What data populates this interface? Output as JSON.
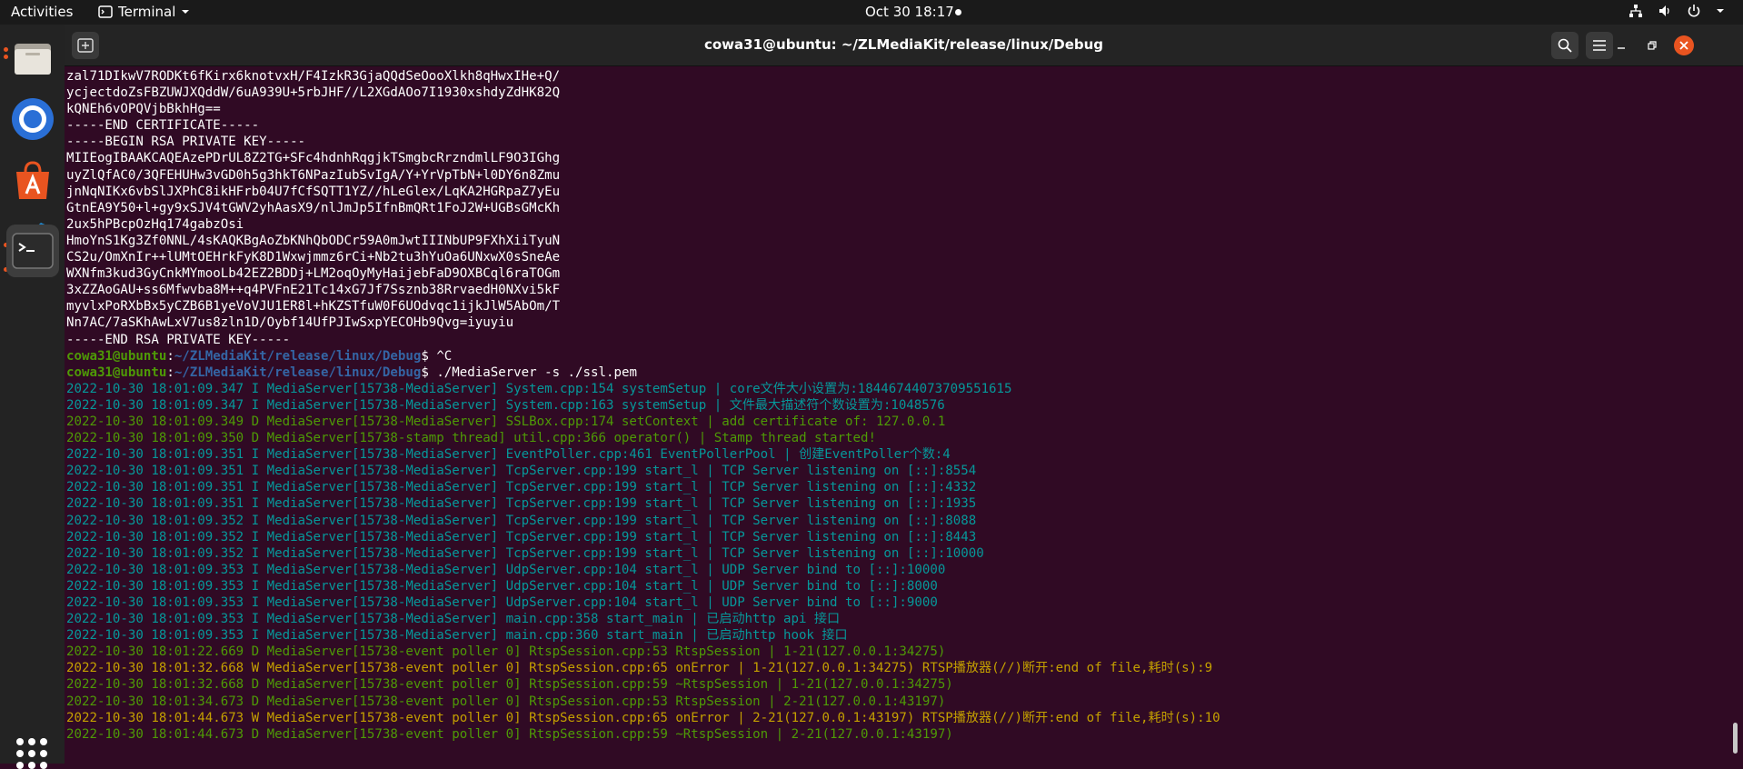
{
  "topbar": {
    "activities": "Activities",
    "app_menu": "Terminal",
    "clock": "Oct 30  18:17"
  },
  "window": {
    "title": "cowa31@ubuntu: ~/ZLMediaKit/release/linux/Debug"
  },
  "dock": {
    "items": [
      "files-icon",
      "chromium-icon",
      "app-store-icon",
      "vscode-icon",
      "terminal-icon",
      "show-applications-icon"
    ]
  },
  "colors": {
    "terminal_bg": "#300a24",
    "green": "#4e9a06",
    "cyan": "#06989a",
    "yellow": "#c4a000",
    "prompt_path": "#3465a4",
    "close": "#e95420"
  },
  "terminal": {
    "lines": [
      {
        "style": "white",
        "text": "zal71DIkwV7RODKt6fKirx6knotvxH/F4IzkR3GjaQQdSeOooXlkh8qHwxIHe+Q/"
      },
      {
        "style": "white",
        "text": "ycjectdoZsFBZUWJXQddW/6uA939U+5rbJHF//L2XGdAOo7I1930xshdyZdHK82Q"
      },
      {
        "style": "white",
        "text": "kQNEh6vOPQVjbBkhHg=="
      },
      {
        "style": "white",
        "text": "-----END CERTIFICATE-----"
      },
      {
        "style": "white",
        "text": "-----BEGIN RSA PRIVATE KEY-----"
      },
      {
        "style": "white",
        "text": "MIIEogIBAAKCAQEAzePDrUL8Z2TG+SFc4hdnhRqgjkTSmgbcRrzndmlLF9O3IGhg"
      },
      {
        "style": "white",
        "text": "uyZlQfAC0/3QFEHUHw3vGD0h5g3hkT6NPazIubSvIgA/Y+YrVpTbN+l0DY6n8Zmu"
      },
      {
        "style": "white",
        "text": "jnNqNIKx6vbSlJXPhC8ikHFrb04U7fCfSQTT1YZ//hLeGlex/LqKA2HGRpaZ7yEu"
      },
      {
        "style": "white",
        "text": "GtnEA9Y50+l+gy9xSJV4tGWV2yhAasX9/nlJmJp5IfnBmQRt1FoJ2W+UGBsGMcKh"
      },
      {
        "style": "white",
        "text": "2ux5hPBcpOzHq174gabzOsi"
      },
      {
        "style": "white",
        "text": "HmoYnS1Kg3Zf0NNL/4sKAQKBgAoZbKNhQbODCr59A0mJwtIIINbUP9FXhXiiTyuN"
      },
      {
        "style": "white",
        "text": "CS2u/OmXnIr++lUMtOEHrkFyK8D1Wxwjmmz6rCi+Nb2tu3hYuOa6UNxwX0sSneAe"
      },
      {
        "style": "white",
        "text": "WXNfm3kud3GyCnkMYmooLb42EZ2BDDj+LM2oqOyMyHaijebFaD9OXBCql6raTOGm"
      },
      {
        "style": "white",
        "text": "3xZZAoGAU+ss6Mfwvba8M++q4PVFnE21Tc14xG7Jf7Ssznb38RrvaedH0NXvi5kF"
      },
      {
        "style": "white",
        "text": "myvlxPoRXbBx5yCZB6B1yeVoVJU1ER8l+hKZSTfuW0F6UOdvqc1ijkJlW5AbOm/T"
      },
      {
        "style": "white",
        "text": "Nn7AC/7aSKhAwLxV7us8zln1D/Oybf14UfPJIwSxpYECOHb9Qvg=iyuyiu"
      },
      {
        "style": "white",
        "text": "-----END RSA PRIVATE KEY-----"
      },
      {
        "style": "prompt",
        "user": "cowa31@ubuntu",
        "sep": ":",
        "path": "~/ZLMediaKit/release/linux/Debug",
        "cmd": "$ ^C"
      },
      {
        "style": "prompt",
        "user": "cowa31@ubuntu",
        "sep": ":",
        "path": "~/ZLMediaKit/release/linux/Debug",
        "cmd": "$ ./MediaServer -s ./ssl.pem"
      },
      {
        "style": "cyan",
        "text": "2022-10-30 18:01:09.347 I MediaServer[15738-MediaServer] System.cpp:154 systemSetup | core文件大小设置为:18446744073709551615"
      },
      {
        "style": "cyan",
        "text": "2022-10-30 18:01:09.347 I MediaServer[15738-MediaServer] System.cpp:163 systemSetup | 文件最大描述符个数设置为:1048576"
      },
      {
        "style": "green",
        "text": "2022-10-30 18:01:09.349 D MediaServer[15738-MediaServer] SSLBox.cpp:174 setContext | add certificate of: 127.0.0.1"
      },
      {
        "style": "green",
        "text": "2022-10-30 18:01:09.350 D MediaServer[15738-stamp thread] util.cpp:366 operator() | Stamp thread started!"
      },
      {
        "style": "cyan",
        "text": "2022-10-30 18:01:09.351 I MediaServer[15738-MediaServer] EventPoller.cpp:461 EventPollerPool | 创建EventPoller个数:4"
      },
      {
        "style": "cyan",
        "text": "2022-10-30 18:01:09.351 I MediaServer[15738-MediaServer] TcpServer.cpp:199 start_l | TCP Server listening on [::]:8554"
      },
      {
        "style": "cyan",
        "text": "2022-10-30 18:01:09.351 I MediaServer[15738-MediaServer] TcpServer.cpp:199 start_l | TCP Server listening on [::]:4332"
      },
      {
        "style": "cyan",
        "text": "2022-10-30 18:01:09.351 I MediaServer[15738-MediaServer] TcpServer.cpp:199 start_l | TCP Server listening on [::]:1935"
      },
      {
        "style": "cyan",
        "text": "2022-10-30 18:01:09.352 I MediaServer[15738-MediaServer] TcpServer.cpp:199 start_l | TCP Server listening on [::]:8088"
      },
      {
        "style": "cyan",
        "text": "2022-10-30 18:01:09.352 I MediaServer[15738-MediaServer] TcpServer.cpp:199 start_l | TCP Server listening on [::]:8443"
      },
      {
        "style": "cyan",
        "text": "2022-10-30 18:01:09.352 I MediaServer[15738-MediaServer] TcpServer.cpp:199 start_l | TCP Server listening on [::]:10000"
      },
      {
        "style": "cyan",
        "text": "2022-10-30 18:01:09.353 I MediaServer[15738-MediaServer] UdpServer.cpp:104 start_l | UDP Server bind to [::]:10000"
      },
      {
        "style": "cyan",
        "text": "2022-10-30 18:01:09.353 I MediaServer[15738-MediaServer] UdpServer.cpp:104 start_l | UDP Server bind to [::]:8000"
      },
      {
        "style": "cyan",
        "text": "2022-10-30 18:01:09.353 I MediaServer[15738-MediaServer] UdpServer.cpp:104 start_l | UDP Server bind to [::]:9000"
      },
      {
        "style": "cyan",
        "text": "2022-10-30 18:01:09.353 I MediaServer[15738-MediaServer] main.cpp:358 start_main | 已启动http api 接口"
      },
      {
        "style": "cyan",
        "text": "2022-10-30 18:01:09.353 I MediaServer[15738-MediaServer] main.cpp:360 start_main | 已启动http hook 接口"
      },
      {
        "style": "green",
        "text": "2022-10-30 18:01:22.669 D MediaServer[15738-event poller 0] RtspSession.cpp:53 RtspSession | 1-21(127.0.0.1:34275)"
      },
      {
        "style": "yellow",
        "text": "2022-10-30 18:01:32.668 W MediaServer[15738-event poller 0] RtspSession.cpp:65 onError | 1-21(127.0.0.1:34275) RTSP播放器(//)断开:end of file,耗时(s):9"
      },
      {
        "style": "green",
        "text": "2022-10-30 18:01:32.668 D MediaServer[15738-event poller 0] RtspSession.cpp:59 ~RtspSession | 1-21(127.0.0.1:34275)"
      },
      {
        "style": "green",
        "text": "2022-10-30 18:01:34.673 D MediaServer[15738-event poller 0] RtspSession.cpp:53 RtspSession | 2-21(127.0.0.1:43197)"
      },
      {
        "style": "yellow",
        "text": "2022-10-30 18:01:44.673 W MediaServer[15738-event poller 0] RtspSession.cpp:65 onError | 2-21(127.0.0.1:43197) RTSP播放器(//)断开:end of file,耗时(s):10"
      },
      {
        "style": "green",
        "text": "2022-10-30 18:01:44.673 D MediaServer[15738-event poller 0] RtspSession.cpp:59 ~RtspSession | 2-21(127.0.0.1:43197)"
      }
    ]
  }
}
